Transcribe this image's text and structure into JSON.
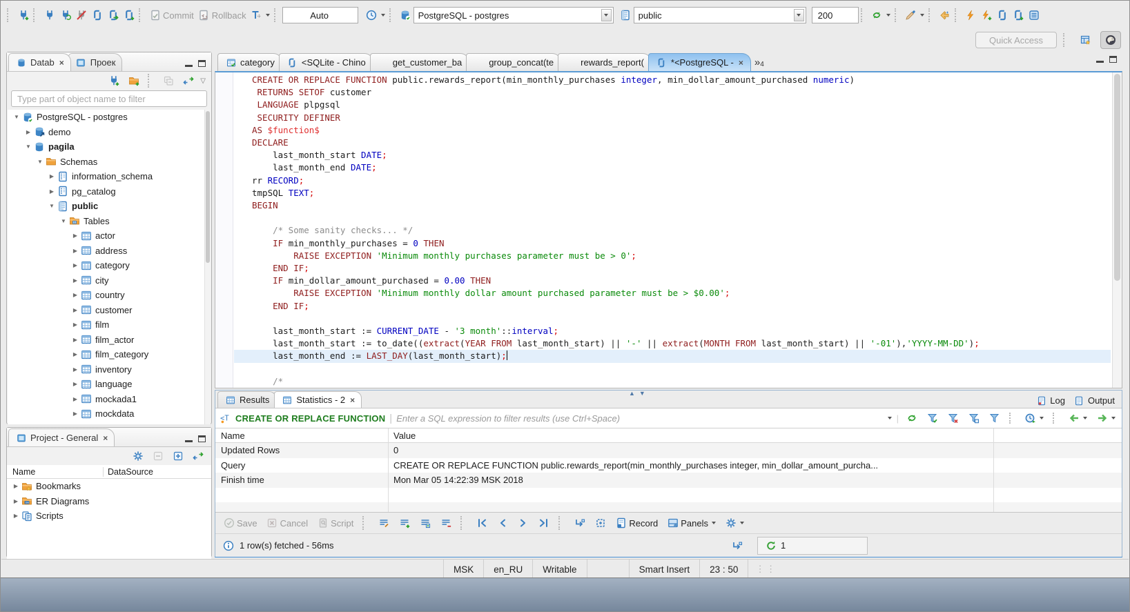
{
  "toolbar": {
    "commit_label": "Commit",
    "rollback_label": "Rollback",
    "tx_mode": "Auto",
    "connection": "PostgreSQL - postgres",
    "schema": "public",
    "fetch_size": "200",
    "quick_access_placeholder": "Quick Access"
  },
  "nav": {
    "tab_database": "Datab",
    "tab_projects": "Проек",
    "filter_placeholder": "Type part of object name to filter",
    "tree": [
      {
        "d": 0,
        "x": "open",
        "i": "db-check",
        "l": "PostgreSQL - postgres"
      },
      {
        "d": 1,
        "x": "closed",
        "i": "db-link",
        "l": "demo"
      },
      {
        "d": 1,
        "x": "open",
        "i": "db",
        "l": "pagila",
        "b": true
      },
      {
        "d": 2,
        "x": "open",
        "i": "folder-db",
        "l": "Schemas"
      },
      {
        "d": 3,
        "x": "closed",
        "i": "schema",
        "l": "information_schema"
      },
      {
        "d": 3,
        "x": "closed",
        "i": "schema",
        "l": "pg_catalog"
      },
      {
        "d": 3,
        "x": "open",
        "i": "schema-b",
        "l": "public",
        "b": true
      },
      {
        "d": 4,
        "x": "open",
        "i": "folder-tbl",
        "l": "Tables"
      },
      {
        "d": 5,
        "x": "closed",
        "i": "table",
        "l": "actor"
      },
      {
        "d": 5,
        "x": "closed",
        "i": "table",
        "l": "address"
      },
      {
        "d": 5,
        "x": "closed",
        "i": "table",
        "l": "category"
      },
      {
        "d": 5,
        "x": "closed",
        "i": "table",
        "l": "city"
      },
      {
        "d": 5,
        "x": "closed",
        "i": "table",
        "l": "country"
      },
      {
        "d": 5,
        "x": "closed",
        "i": "table",
        "l": "customer"
      },
      {
        "d": 5,
        "x": "closed",
        "i": "table",
        "l": "film"
      },
      {
        "d": 5,
        "x": "closed",
        "i": "table",
        "l": "film_actor"
      },
      {
        "d": 5,
        "x": "closed",
        "i": "table",
        "l": "film_category"
      },
      {
        "d": 5,
        "x": "closed",
        "i": "table",
        "l": "inventory"
      },
      {
        "d": 5,
        "x": "closed",
        "i": "table",
        "l": "language"
      },
      {
        "d": 5,
        "x": "closed",
        "i": "table",
        "l": "mockada1"
      },
      {
        "d": 5,
        "x": "closed",
        "i": "table",
        "l": "mockdata"
      }
    ]
  },
  "project": {
    "title": "Project - General",
    "col_name": "Name",
    "col_datasource": "DataSource",
    "items": [
      {
        "i": "folder-bm",
        "l": "Bookmarks"
      },
      {
        "i": "folder-er",
        "l": "ER Diagrams"
      },
      {
        "i": "scripts",
        "l": "Scripts"
      }
    ]
  },
  "editor": {
    "tabs": [
      {
        "i": "table-check",
        "l": "category"
      },
      {
        "i": "sql",
        "l": "<SQLite - Chino"
      },
      {
        "i": "fn",
        "l": "get_customer_ba"
      },
      {
        "i": "fn",
        "l": "group_concat(te"
      },
      {
        "i": "fn",
        "l": "rewards_report("
      },
      {
        "i": "sql",
        "l": "*<PostgreSQL - ",
        "active": true
      }
    ],
    "overflow_count": "4",
    "current_line": 22,
    "code": [
      [
        [
          "k",
          "CREATE OR REPLACE FUNCTION"
        ],
        [
          "p",
          " public.rewards_report(min_monthly_purchases "
        ],
        [
          "t",
          "integer"
        ],
        [
          "p",
          ", min_dollar_amount_purchased "
        ],
        [
          "t",
          "numeric"
        ],
        [
          "p",
          ")"
        ]
      ],
      [
        [
          "p",
          " "
        ],
        [
          "k",
          "RETURNS SETOF"
        ],
        [
          "p",
          " customer"
        ]
      ],
      [
        [
          "p",
          " "
        ],
        [
          "k",
          "LANGUAGE"
        ],
        [
          "p",
          " plpgsql"
        ]
      ],
      [
        [
          "p",
          " "
        ],
        [
          "k",
          "SECURITY DEFINER"
        ]
      ],
      [
        [
          "k",
          "AS"
        ],
        [
          "p",
          " "
        ],
        [
          "dd",
          "$function$"
        ]
      ],
      [
        [
          "k",
          "DECLARE"
        ]
      ],
      [
        [
          "p",
          "    last_month_start "
        ],
        [
          "t",
          "DATE"
        ],
        [
          "d",
          ";"
        ]
      ],
      [
        [
          "p",
          "    last_month_end "
        ],
        [
          "t",
          "DATE"
        ],
        [
          "d",
          ";"
        ]
      ],
      [
        [
          "p",
          "rr "
        ],
        [
          "t",
          "RECORD"
        ],
        [
          "d",
          ";"
        ]
      ],
      [
        [
          "p",
          "tmpSQL "
        ],
        [
          "t",
          "TEXT"
        ],
        [
          "d",
          ";"
        ]
      ],
      [
        [
          "k",
          "BEGIN"
        ]
      ],
      [],
      [
        [
          "c",
          "    /* Some sanity checks... */"
        ]
      ],
      [
        [
          "p",
          "    "
        ],
        [
          "k",
          "IF"
        ],
        [
          "p",
          " min_monthly_purchases = "
        ],
        [
          "n",
          "0"
        ],
        [
          "p",
          " "
        ],
        [
          "k",
          "THEN"
        ]
      ],
      [
        [
          "p",
          "        "
        ],
        [
          "k",
          "RAISE EXCEPTION"
        ],
        [
          "p",
          " "
        ],
        [
          "s",
          "'Minimum monthly purchases parameter must be > 0'"
        ],
        [
          "d",
          ";"
        ]
      ],
      [
        [
          "p",
          "    "
        ],
        [
          "k",
          "END IF"
        ],
        [
          "d",
          ";"
        ]
      ],
      [
        [
          "p",
          "    "
        ],
        [
          "k",
          "IF"
        ],
        [
          "p",
          " min_dollar_amount_purchased = "
        ],
        [
          "n",
          "0.00"
        ],
        [
          "p",
          " "
        ],
        [
          "k",
          "THEN"
        ]
      ],
      [
        [
          "p",
          "        "
        ],
        [
          "k",
          "RAISE EXCEPTION"
        ],
        [
          "p",
          " "
        ],
        [
          "s",
          "'Minimum monthly dollar amount purchased parameter must be > $0.00'"
        ],
        [
          "d",
          ";"
        ]
      ],
      [
        [
          "p",
          "    "
        ],
        [
          "k",
          "END IF"
        ],
        [
          "d",
          ";"
        ]
      ],
      [],
      [
        [
          "p",
          "    last_month_start := "
        ],
        [
          "t",
          "CURRENT_DATE"
        ],
        [
          "p",
          " - "
        ],
        [
          "s",
          "'3 month'"
        ],
        [
          "p",
          "::"
        ],
        [
          "t",
          "interval"
        ],
        [
          "d",
          ";"
        ]
      ],
      [
        [
          "p",
          "    last_month_start := to_date(("
        ],
        [
          "k",
          "extract"
        ],
        [
          "p",
          "("
        ],
        [
          "k",
          "YEAR FROM"
        ],
        [
          "p",
          " last_month_start) || "
        ],
        [
          "s",
          "'-'"
        ],
        [
          "p",
          " || "
        ],
        [
          "k",
          "extract"
        ],
        [
          "p",
          "("
        ],
        [
          "k",
          "MONTH FROM"
        ],
        [
          "p",
          " last_month_start) || "
        ],
        [
          "s",
          "'-01'"
        ],
        [
          "p",
          "),"
        ],
        [
          "s",
          "'YYYY-MM-DD'"
        ],
        [
          "p",
          ")"
        ],
        [
          "d",
          ";"
        ]
      ],
      [
        [
          "p",
          "    last_month_end := "
        ],
        [
          "k",
          "LAST_DAY"
        ],
        [
          "p",
          "(last_month_start)"
        ],
        [
          "d",
          ";"
        ]
      ],
      [],
      [
        [
          "c",
          "    /*"
        ]
      ]
    ]
  },
  "results": {
    "tab_results": "Results",
    "tab_statistics": "Statistics - 2",
    "log_label": "Log",
    "output_label": "Output",
    "filter_text": "CREATE OR REPLACE FUNCTION",
    "filter_placeholder": "Enter a SQL expression to filter results (use Ctrl+Space)",
    "table": {
      "headers": [
        "Name",
        "Value"
      ],
      "rows": [
        [
          "Updated Rows",
          "0"
        ],
        [
          "Query",
          "CREATE OR REPLACE FUNCTION public.rewards_report(min_monthly_purchases integer, min_dollar_amount_purcha..."
        ],
        [
          "Finish time",
          "Mon Mar 05 14:22:39 MSK 2018"
        ]
      ]
    },
    "toolbar": {
      "save": "Save",
      "cancel": "Cancel",
      "script": "Script",
      "record": "Record",
      "panels": "Panels"
    },
    "status_text": "1 row(s) fetched - 56ms",
    "exec_count": "1"
  },
  "statusbar": {
    "segments": [
      "MSK",
      "en_RU",
      "Writable",
      "Smart Insert",
      "23 : 50"
    ]
  },
  "colors": {
    "accent": "#3a7fc1",
    "kw": "#8f1d1d",
    "typ": "#0000c0",
    "num": "#0000c0",
    "str": "#0a8a0a",
    "com": "#8c8c8c",
    "delim": "#d40000",
    "tabActiveTop": "#8fc1ef",
    "tabActiveBottom": "#c9e2f8"
  }
}
